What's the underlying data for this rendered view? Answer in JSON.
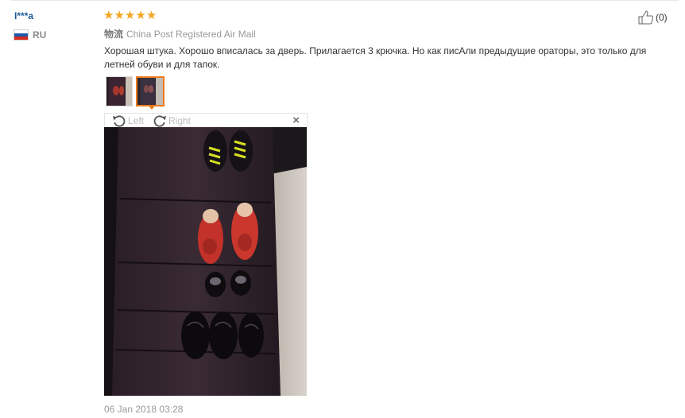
{
  "reviewer": {
    "name": "I***a",
    "country_code": "RU",
    "flag_colors": [
      "#ffffff",
      "#1c57a7",
      "#d52b1e"
    ]
  },
  "review": {
    "rating": 5,
    "rating_max": 5,
    "star_color": "#f5a623",
    "logistics_label": "物流",
    "logistics_value": "China Post Registered Air Mail",
    "text": "Хорошая штука. Хорошо вписалась за дверь. Прилагается 3 крючка. Но как писАли предыдущие ораторы, это только для летней обуви и для тапок.",
    "date": "06 Jan 2018 03:28",
    "helpful_count": "(0)"
  },
  "gallery": {
    "thumbnails": [
      {
        "name": "photo-thumb-1",
        "active": false
      },
      {
        "name": "photo-thumb-2",
        "active": true
      }
    ],
    "active_border_color": "#ee7a1b"
  },
  "viewer": {
    "rotate_left_label": "Left",
    "rotate_right_label": "Right",
    "close_symbol": "×"
  }
}
